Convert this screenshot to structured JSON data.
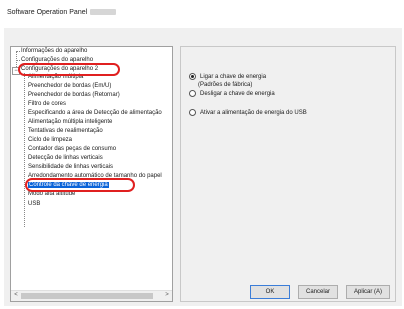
{
  "window": {
    "title": "Software Operation Panel"
  },
  "tree": {
    "items": [
      {
        "label": "Informações do aparelho"
      },
      {
        "label": "Configurações do aparelho"
      },
      {
        "label": "Configurações do aparelho 2"
      },
      {
        "label": "Alimentação múltipla"
      },
      {
        "label": "Preenchedor de bordas (Em/U)"
      },
      {
        "label": "Preenchedor de bordas (Retornar)"
      },
      {
        "label": "Filtro de cores"
      },
      {
        "label": "Especificando a área de Detecção de alimentação"
      },
      {
        "label": "Alimentação múltipla inteligente"
      },
      {
        "label": "Tentativas de realimentação"
      },
      {
        "label": "Ciclo de limpeza"
      },
      {
        "label": "Contador das peças de consumo"
      },
      {
        "label": "Detecção de linhas verticais"
      },
      {
        "label": "Sensibilidade de linhas verticais"
      },
      {
        "label": "Arredondamento automático de tamanho do papel"
      },
      {
        "label": "Controle da chave de energia"
      },
      {
        "label": "Modo alta altitude"
      },
      {
        "label": "USB"
      }
    ],
    "selected_index": 15
  },
  "options": [
    {
      "label": "Ligar a chave de energia",
      "sub": "(Padrões de fábrica)",
      "checked": true
    },
    {
      "label": "Desligar a chave de energia",
      "checked": false
    },
    {
      "label": "Ativar a alimentação de energia do USB",
      "checked": false
    }
  ],
  "buttons": {
    "ok": "OK",
    "cancel": "Cancelar",
    "apply": "Aplicar (A)"
  },
  "colors": {
    "selection": "#0a64d8",
    "annotation": "#e02020"
  }
}
